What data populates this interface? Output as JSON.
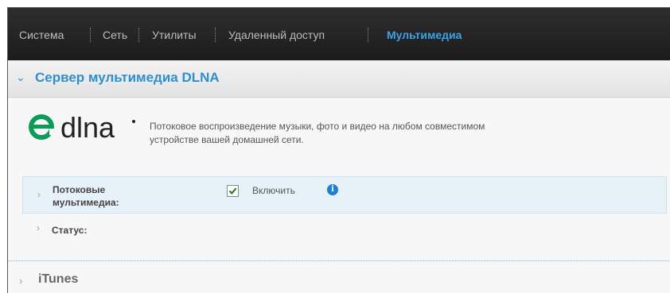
{
  "nav": {
    "items": [
      {
        "label": "Система",
        "active": false
      },
      {
        "label": "Сеть",
        "active": false
      },
      {
        "label": "Утилиты",
        "active": false
      },
      {
        "label": "Удаленный доступ",
        "active": false
      },
      {
        "label": "Мультимедиа",
        "active": true
      }
    ]
  },
  "dlna_section": {
    "title": "Сервер мультимедиа DLNA",
    "logo_text": "dlna",
    "description_line1": "Потоковое воспроизведение музыки, фото и видео на любом совместимом",
    "description_line2": "устройстве вашей домашней сети.",
    "streaming": {
      "label_line1": "Потоковые",
      "label_line2": "мультимедиа:",
      "checkbox_label": "Включить",
      "checked": true,
      "info_symbol": "i"
    },
    "status": {
      "label": "Статус:"
    }
  },
  "itunes_section": {
    "title": "iTunes"
  },
  "colors": {
    "accent": "#2e8fcf",
    "nav_active": "#3aa2e6",
    "nav_bg": "#1c1c1c",
    "logo_green": "#0e9a57"
  }
}
